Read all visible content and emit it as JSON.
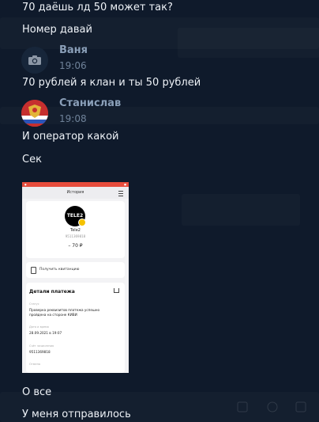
{
  "messages_top": [
    {
      "text": "70 даёшь лд 50 может так?"
    },
    {
      "text": "Номер давай"
    }
  ],
  "sender1": {
    "name": "Ваня",
    "time": "19:06",
    "icon": "camera-icon",
    "message": "70 рублей я клан и ты 50 рублей"
  },
  "sender2": {
    "name": "Станислав",
    "time": "19:08",
    "icon": "coat-of-arms-avatar",
    "messages": [
      "И оператор какой",
      "Сек"
    ]
  },
  "receipt": {
    "header_title": "История",
    "operator": "Tele2",
    "logo_text": "TELE2",
    "amount": "– 70 ₽",
    "receipt_link": "Получить квитанцию",
    "details_title": "Детали платежа",
    "status_label": "Статус",
    "status_value_line1": "Проверка реквизитов платежа успешно",
    "status_value_line2": "пройдена на стороне КИВИ",
    "date_label": "Дата и время",
    "date_value": "28.09.2021 в 19:07",
    "account_label": "Счёт зачисления",
    "account_value": "9511369818",
    "extra_label": "Отмена"
  },
  "messages_bottom": [
    {
      "text": "О все"
    },
    {
      "text": "У меня отправилось"
    }
  ],
  "colors": {
    "background": "#0f1a2b",
    "sender_name": "#8a9fb8",
    "time": "#6f8299",
    "text": "#eef2f7"
  }
}
